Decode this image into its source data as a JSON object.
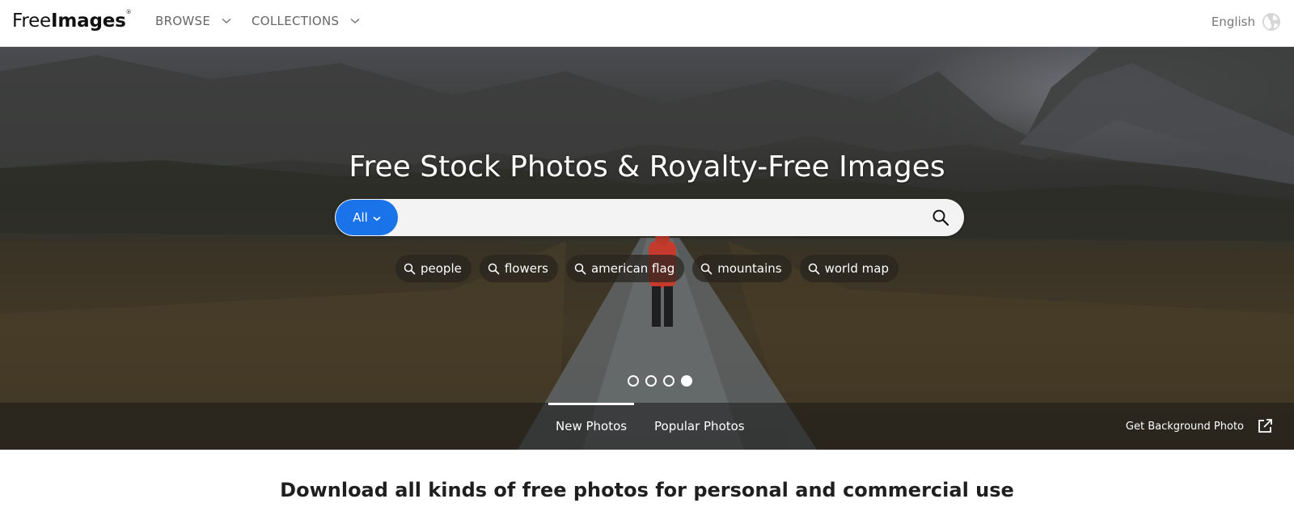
{
  "header": {
    "logo": {
      "part1": "Free",
      "part2": "Images",
      "mark": "®"
    },
    "nav": [
      {
        "label": "BROWSE",
        "icon": "chevron-down-icon"
      },
      {
        "label": "COLLECTIONS",
        "icon": "chevron-down-icon"
      }
    ],
    "language": {
      "label": "English",
      "icon": "globe-icon"
    }
  },
  "hero": {
    "title": "Free Stock Photos & Royalty-Free Images",
    "search": {
      "filter_label": "All",
      "placeholder": "",
      "value": "",
      "button_icon": "search-icon"
    },
    "tags": [
      "people",
      "flowers",
      "american flag",
      "mountains",
      "world map"
    ],
    "carousel": {
      "count": 4,
      "active_index": 3
    },
    "tabs": [
      {
        "label": "New Photos",
        "active": true
      },
      {
        "label": "Popular Photos",
        "active": false
      }
    ],
    "background_link": {
      "label": "Get Background Photo",
      "icon": "external-link-icon"
    }
  },
  "tagline": "Download all kinds of free photos for personal and commercial use",
  "colors": {
    "accent": "#1a73e8",
    "header_bg": "#ffffff",
    "nav_text": "#666666"
  }
}
